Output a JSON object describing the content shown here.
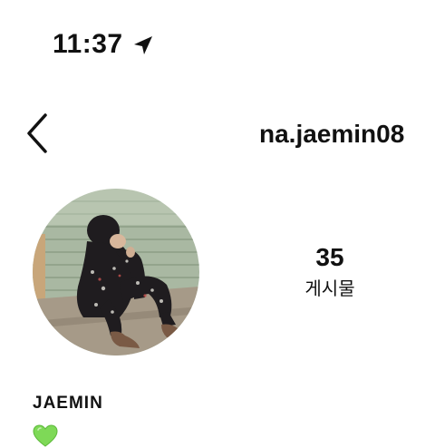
{
  "status_bar": {
    "time": "11:37",
    "location_icon": "location-arrow-icon"
  },
  "header": {
    "back_icon": "chevron-left-icon",
    "username": "na.jaemin08"
  },
  "profile": {
    "avatar_icon": "profile-photo",
    "posts_count": "35",
    "posts_label": "게시물",
    "display_name": "JAEMIN",
    "bio_icon": "green-heart-icon"
  },
  "colors": {
    "text": "#111111",
    "background": "#ffffff",
    "heart": "#7ed957"
  }
}
